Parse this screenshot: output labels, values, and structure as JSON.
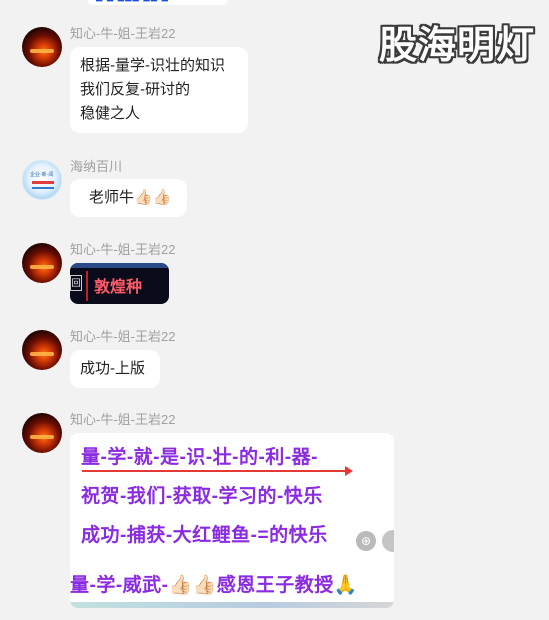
{
  "watermark": "股海明灯",
  "messages": [
    {
      "sender": "知心-牛-姐-王岩22",
      "text_lines": [
        "根据-量学-识壮的知识",
        "我们反复-研讨的",
        "稳健之人"
      ]
    },
    {
      "sender": "海纳百川",
      "text": "老师牛👍🏻👍🏻"
    },
    {
      "sender": "知心-牛-姐-王岩22",
      "image_text": "敦煌种",
      "image_frame_glyph": "回"
    },
    {
      "sender": "知心-牛-姐-王岩22",
      "text": "成功-上版"
    },
    {
      "sender": "知心-牛-姐-王岩22",
      "image_lines": [
        "量-学-就-是-识-壮-的-利-器-",
        "祝贺-我们-获取-学习的-快乐",
        "成功-捕获-大红鲤鱼-=的快乐",
        "量-学-威武-👍🏻👍🏻感恩王子教授🙏"
      ]
    }
  ],
  "icons": {
    "zoom": "zoom-in-icon",
    "more": "more-icon"
  }
}
